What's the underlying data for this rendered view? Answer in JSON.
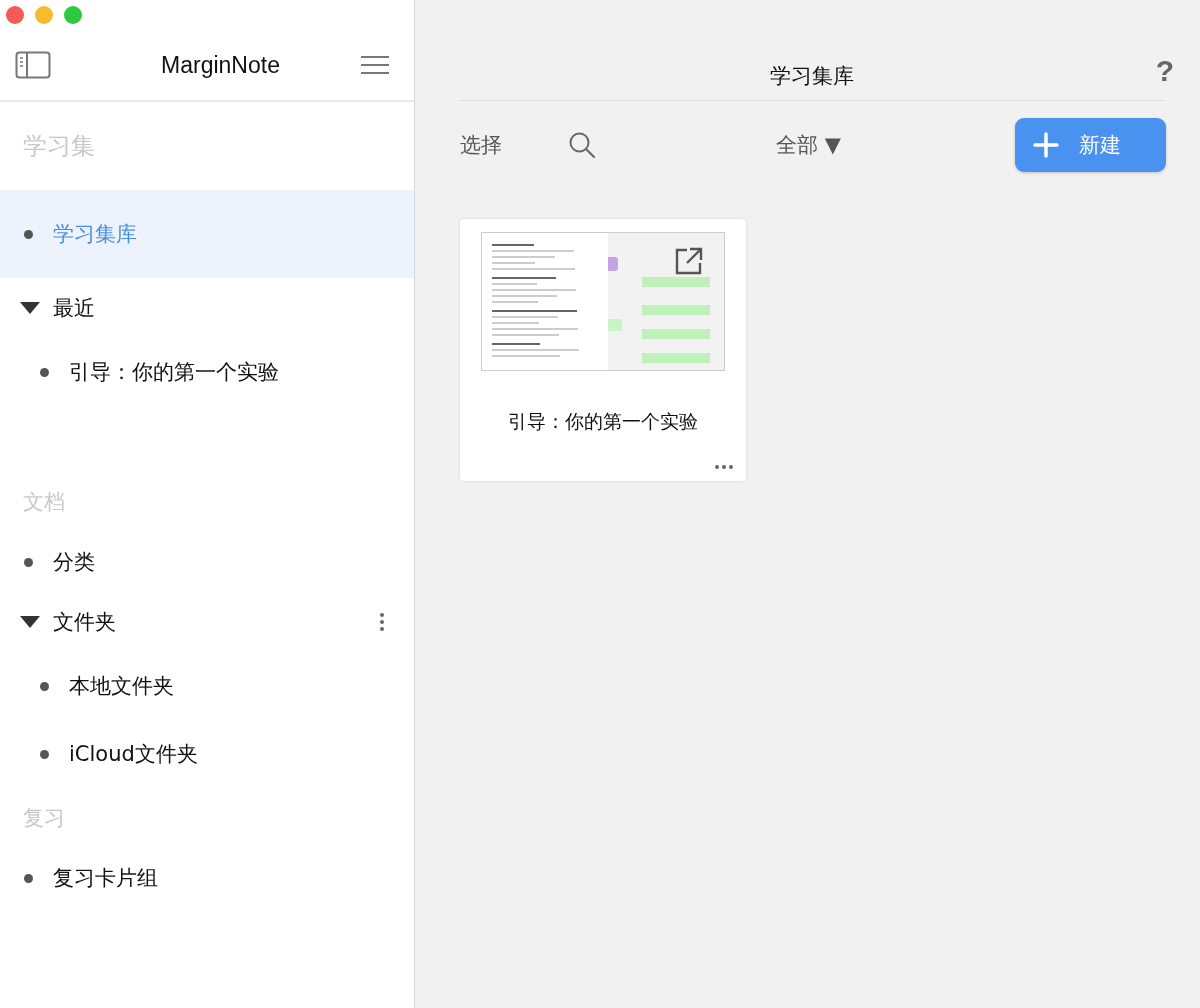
{
  "sidebar": {
    "title": "MarginNote",
    "sections": [
      {
        "title": "学习集",
        "items": [
          {
            "kind": "item",
            "label": "学习集库",
            "selected": true,
            "has_menu": false
          },
          {
            "kind": "group",
            "label": "最近",
            "selected": false,
            "expanded": true,
            "has_menu": false,
            "children": [
              {
                "kind": "item",
                "label": "引导：你的第一个实验",
                "selected": false,
                "has_menu": false
              }
            ]
          }
        ]
      },
      {
        "title": "文档",
        "items": [
          {
            "kind": "item",
            "label": "分类",
            "selected": false,
            "has_menu": false
          },
          {
            "kind": "group",
            "label": "文件夹",
            "selected": false,
            "expanded": true,
            "has_menu": true,
            "children": [
              {
                "kind": "item",
                "label": "本地文件夹",
                "selected": false,
                "has_menu": false
              },
              {
                "kind": "item",
                "label": "iCloud文件夹",
                "selected": false,
                "has_menu": false
              }
            ]
          }
        ]
      },
      {
        "title": "复习",
        "items": [
          {
            "kind": "item",
            "label": "复习卡片组",
            "selected": false,
            "has_menu": false
          }
        ]
      }
    ]
  },
  "main": {
    "title": "学习集库",
    "help": "?",
    "toolbar": {
      "select": "选择",
      "filter": "全部 ▼",
      "new_button": "新建"
    },
    "cards": [
      {
        "title": "引导：你的第一个实验"
      }
    ]
  }
}
